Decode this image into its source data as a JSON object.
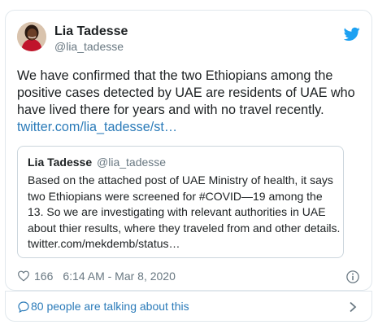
{
  "tweet": {
    "author_name": "Lia Tadesse",
    "author_handle": "@lia_tadesse",
    "text": "We have confirmed that the two Ethiopians among the positive cases  detected by UAE are residents of UAE who have lived there for years and with no travel recently.",
    "link": "twitter.com/lia_tadesse/st…",
    "likes": "166",
    "timestamp": "6:14 AM - Mar 8, 2020"
  },
  "quote": {
    "author_name": "Lia Tadesse",
    "author_handle": "@lia_tadesse",
    "text": "Based on the attached post of UAE Ministry of health,  it says two Ethiopians were screened for #COVID—19 among the 13. So we are investigating with relevant authorities in UAE about thier results, where they traveled from and other details. twitter.com/mekdemb/status…"
  },
  "footer": {
    "talking_text": "80 people are talking about this"
  },
  "icons": {
    "brand": "twitter-bird-icon",
    "like": "heart-icon",
    "info": "info-icon",
    "talk": "comment-icon",
    "chevron": "chevron-right-icon"
  },
  "colors": {
    "link": "#2b7bb9",
    "brand": "#1da1f2",
    "muted": "#697882",
    "border": "#e1e8ed"
  }
}
